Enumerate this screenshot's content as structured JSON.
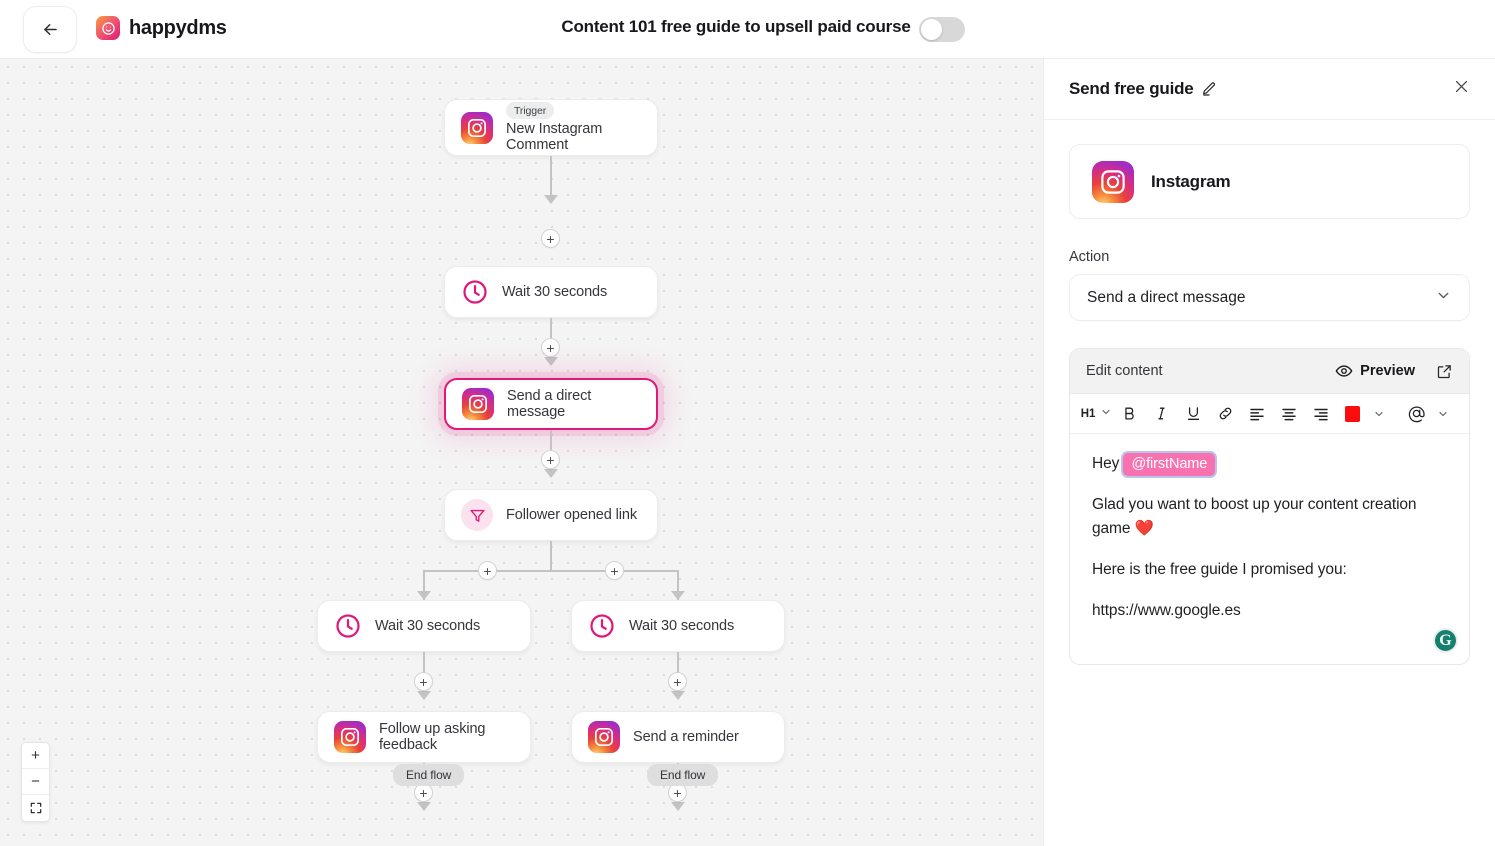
{
  "header": {
    "back_label": "←",
    "brand": "happydms",
    "flow_title": "Content 101 free guide to upsell paid course",
    "toggle_state": "off"
  },
  "canvas": {
    "zoom_controls": {
      "zoom_in": "+",
      "zoom_out": "−",
      "fit": "fit-screen"
    },
    "nodes": [
      {
        "id": "trigger",
        "badge": "Trigger",
        "label": "New Instagram Comment",
        "icon": "instagram-icon",
        "selected": false
      },
      {
        "id": "wait1",
        "badge": "",
        "label": "Wait 30 seconds",
        "icon": "clock-icon",
        "selected": false
      },
      {
        "id": "dm",
        "badge": "",
        "label": "Send a direct message",
        "icon": "instagram-icon",
        "selected": true
      },
      {
        "id": "condition",
        "badge": "",
        "label": "Follower opened link",
        "icon": "filter-icon",
        "selected": false
      },
      {
        "id": "wait-left",
        "badge": "",
        "label": "Wait 30 seconds",
        "icon": "clock-icon",
        "selected": false
      },
      {
        "id": "wait-right",
        "badge": "",
        "label": "Wait 30 seconds",
        "icon": "clock-icon",
        "selected": false
      },
      {
        "id": "followup",
        "badge": "",
        "label": "Follow up asking feedback",
        "icon": "instagram-icon",
        "selected": false
      },
      {
        "id": "reminder",
        "badge": "",
        "label": "Send a reminder",
        "icon": "instagram-icon",
        "selected": false
      }
    ],
    "end_flow_left": "End flow",
    "end_flow_right": "End flow",
    "add_step_label": "+"
  },
  "panel": {
    "title": "Send free guide",
    "close_label": "×",
    "account": {
      "name": "Instagram",
      "icon": "instagram-icon"
    },
    "action_label": "Action",
    "action_value": "Send a direct message",
    "editor": {
      "header_label": "Edit content",
      "preview_label": "Preview",
      "toolbar": {
        "heading": "H1",
        "bold": "B",
        "italic": "I",
        "underline": "U",
        "link": "link-icon",
        "align_left": "align-left-icon",
        "align_center": "align-center-icon",
        "align_right": "align-right-icon",
        "color": "#fb0d0d",
        "mention": "@"
      },
      "message": {
        "line1_prefix": "Hey",
        "line1_token": "@firstName",
        "line2": "Glad you want to boost up your content creation game ❤️",
        "line3": "Here is the free guide I promised you:",
        "line4": "https://www.google.es"
      },
      "grammarly_badge": "G"
    }
  },
  "colors": {
    "accent_pink": "#e0187a",
    "token_pink": "#f972b0",
    "grammarly_green": "#15806b",
    "canvas_bg": "#f4f4f4"
  }
}
